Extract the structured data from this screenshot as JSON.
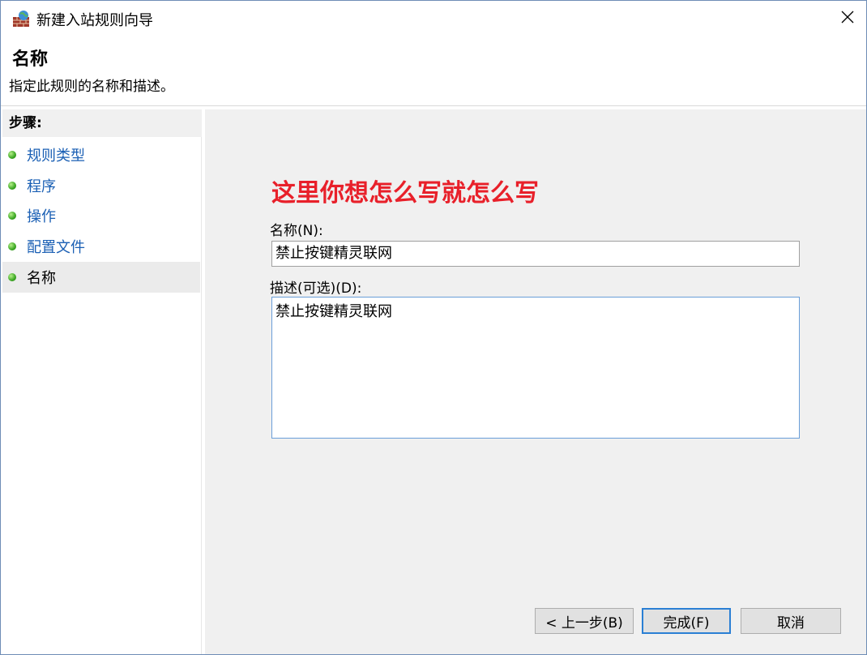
{
  "window": {
    "title": "新建入站规则向导",
    "app_icon": "firewall-icon",
    "close_icon": "close-icon"
  },
  "header": {
    "title": "名称",
    "subtitle": "指定此规则的名称和描述。"
  },
  "sidebar": {
    "heading": "步骤:",
    "items": [
      {
        "label": "规则类型"
      },
      {
        "label": "程序"
      },
      {
        "label": "操作"
      },
      {
        "label": "配置文件"
      },
      {
        "label": "名称"
      }
    ],
    "active_index": 4
  },
  "form": {
    "annotation": "这里你想怎么写就怎么写",
    "annotation_color": "#e8202a",
    "name_label": "名称(N):",
    "name_value": "禁止按键精灵联网",
    "description_label": "描述(可选)(D):",
    "description_value": "禁止按键精灵联网"
  },
  "buttons": {
    "back": "< 上一步(B)",
    "finish": "完成(F)",
    "cancel": "取消"
  }
}
